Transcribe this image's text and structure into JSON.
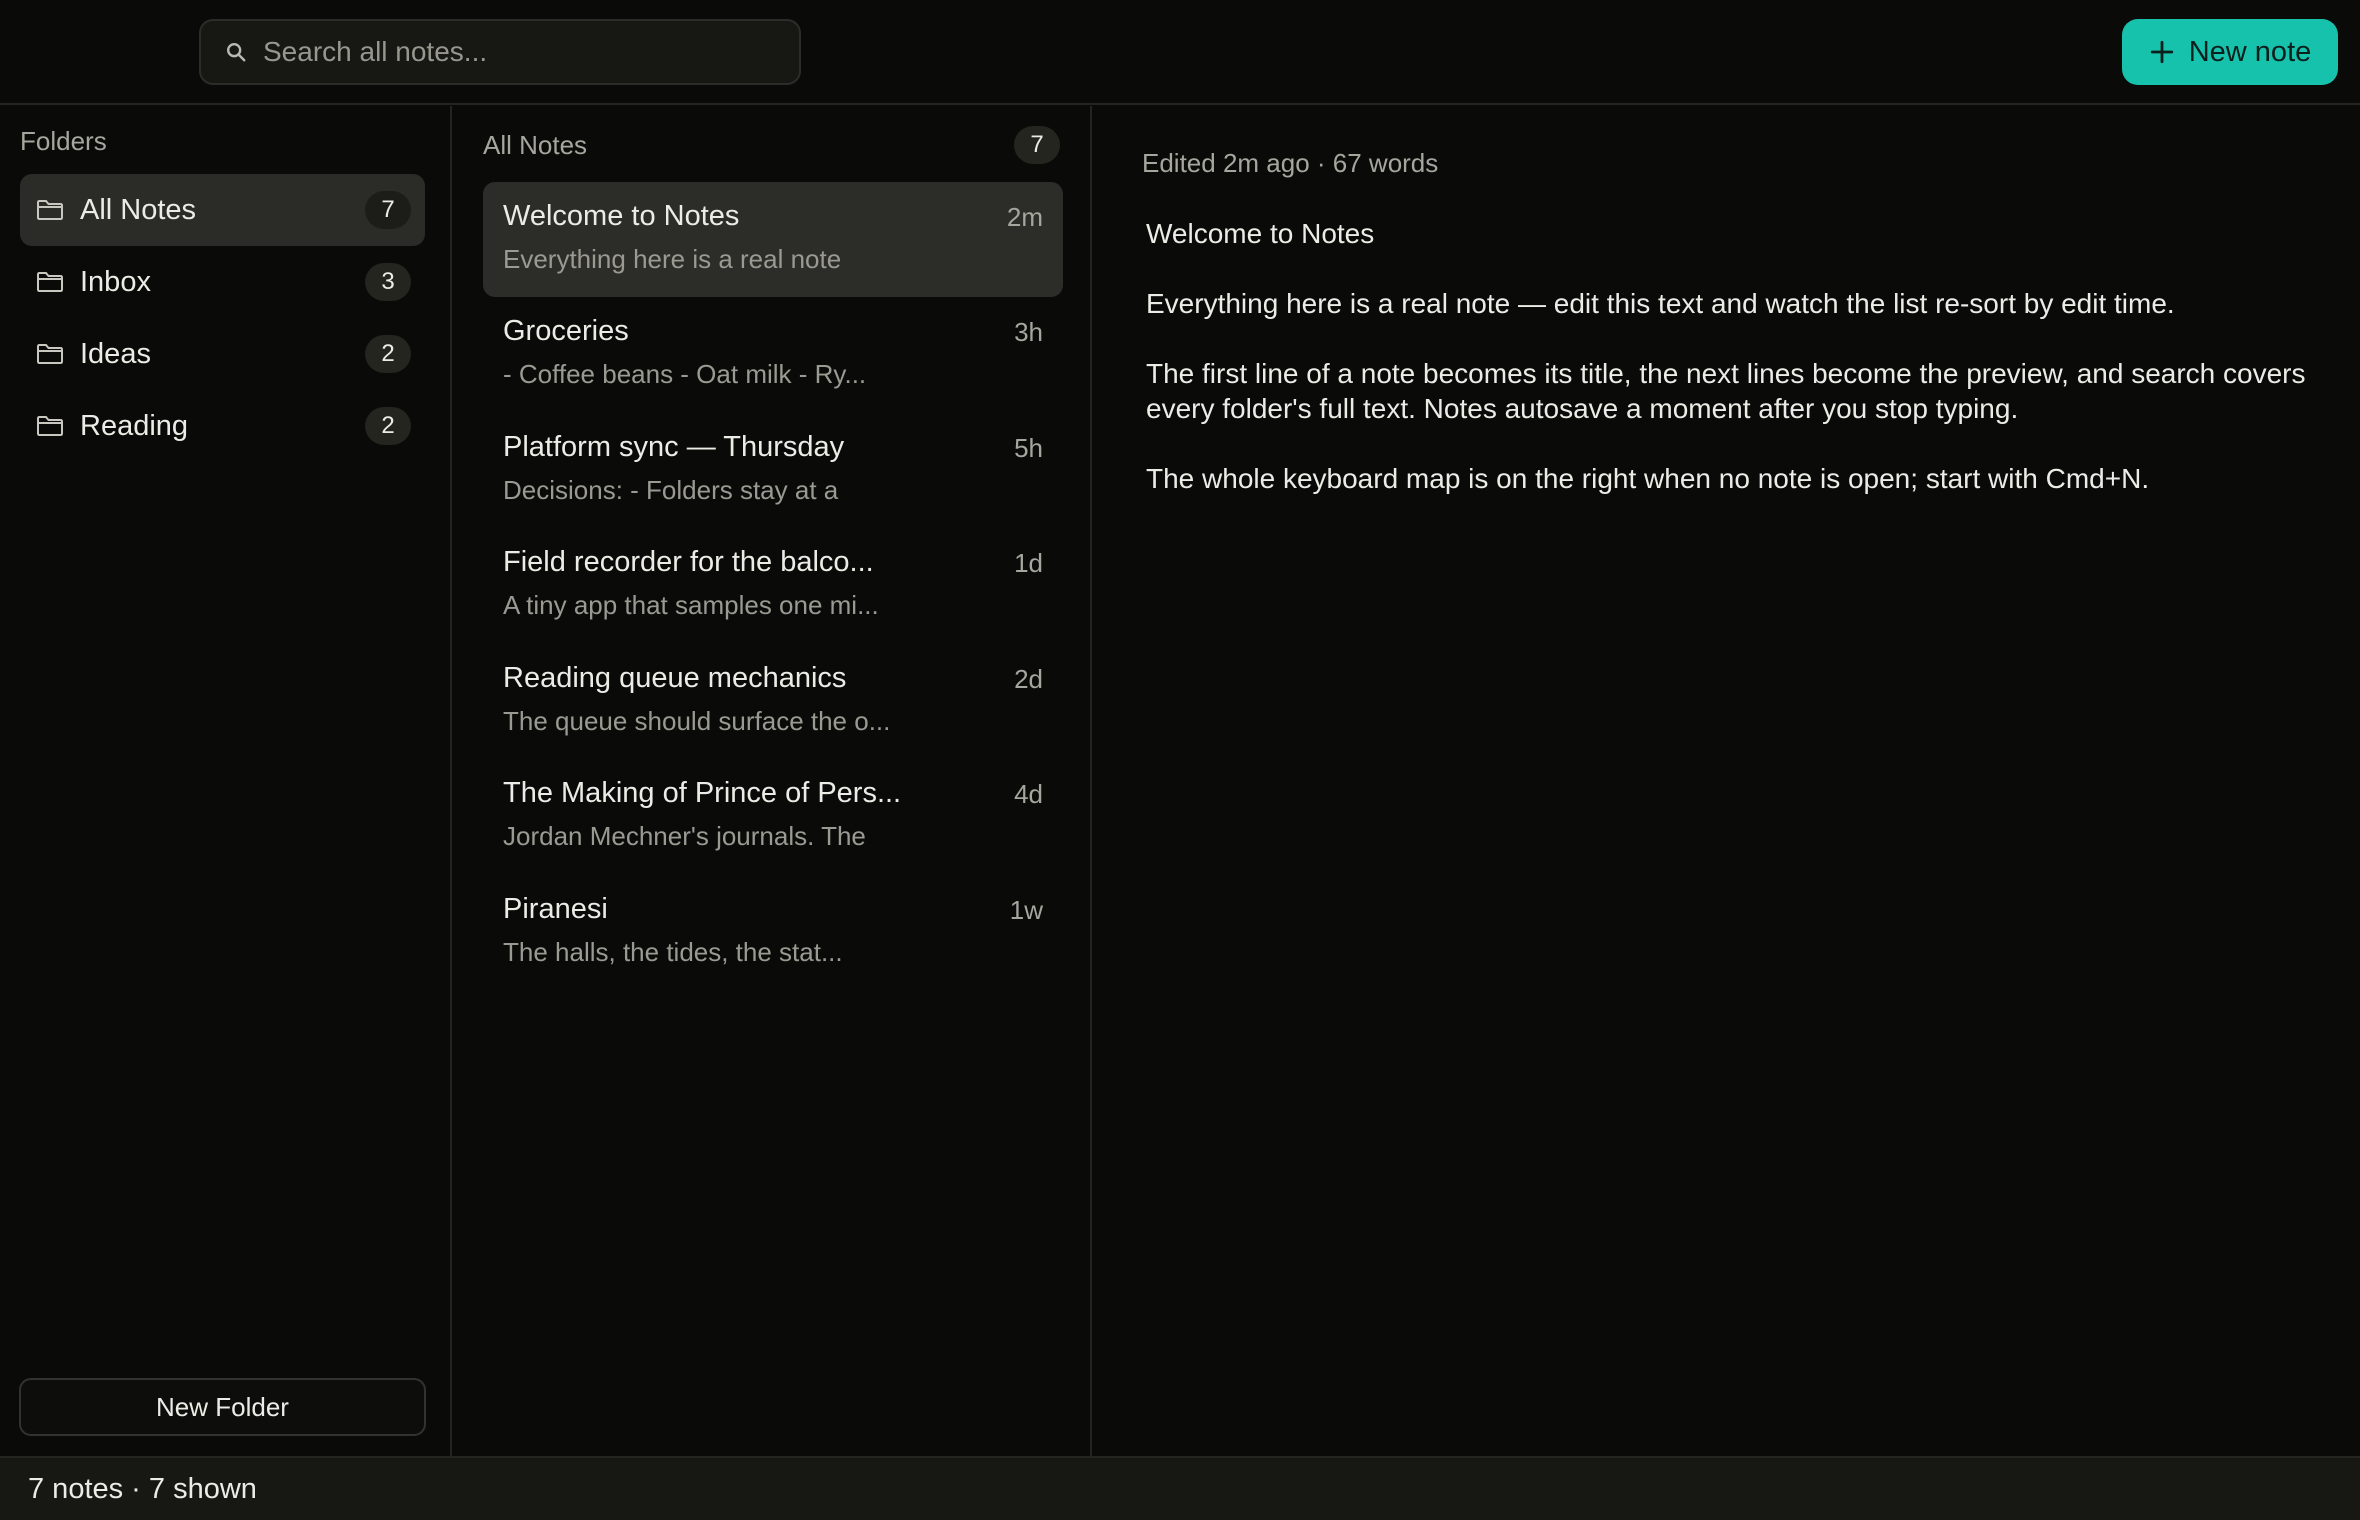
{
  "header": {
    "search_placeholder": "Search all notes...",
    "new_note_label": "New note"
  },
  "sidebar": {
    "title": "Folders",
    "folders": [
      {
        "label": "All Notes",
        "count": "7",
        "active": true
      },
      {
        "label": "Inbox",
        "count": "3"
      },
      {
        "label": "Ideas",
        "count": "2"
      },
      {
        "label": "Reading",
        "count": "2"
      }
    ],
    "new_folder_label": "New Folder"
  },
  "notelist": {
    "title": "All Notes",
    "count": "7",
    "notes": [
      {
        "title": "Welcome to Notes",
        "time": "2m",
        "preview": "Everything here is a real note"
      },
      {
        "title": "Groceries",
        "time": "3h",
        "preview": "- Coffee beans - Oat milk - Ry..."
      },
      {
        "title": "Platform sync — Thursday",
        "time": "5h",
        "preview": "Decisions: - Folders stay at a"
      },
      {
        "title": "Field recorder for the balco...",
        "time": "1d",
        "preview": "A tiny app that samples one mi..."
      },
      {
        "title": "Reading queue mechanics",
        "time": "2d",
        "preview": "The queue should surface the o..."
      },
      {
        "title": "The Making of Prince of Pers...",
        "time": "4d",
        "preview": "Jordan Mechner's journals. The"
      },
      {
        "title": "Piranesi",
        "time": "1w",
        "preview": "The halls, the tides, the stat..."
      }
    ]
  },
  "editor": {
    "meta": "Edited 2m ago · 67 words",
    "paragraphs": [
      "Welcome to Notes",
      "Everything here is a real note — edit this text and watch the list re-sort by edit time.",
      "The first line of a note becomes its title, the next lines become the preview, and search covers every folder's full text. Notes autosave a moment after you stop typing.",
      "The whole keyboard map is on the right when no note is open; start with Cmd+N."
    ]
  },
  "statusbar": {
    "text": "7 notes · 7 shown"
  },
  "colors": {
    "accent": "#17c2ad",
    "background": "#0a0a08",
    "active_row": "#2c2c28"
  }
}
